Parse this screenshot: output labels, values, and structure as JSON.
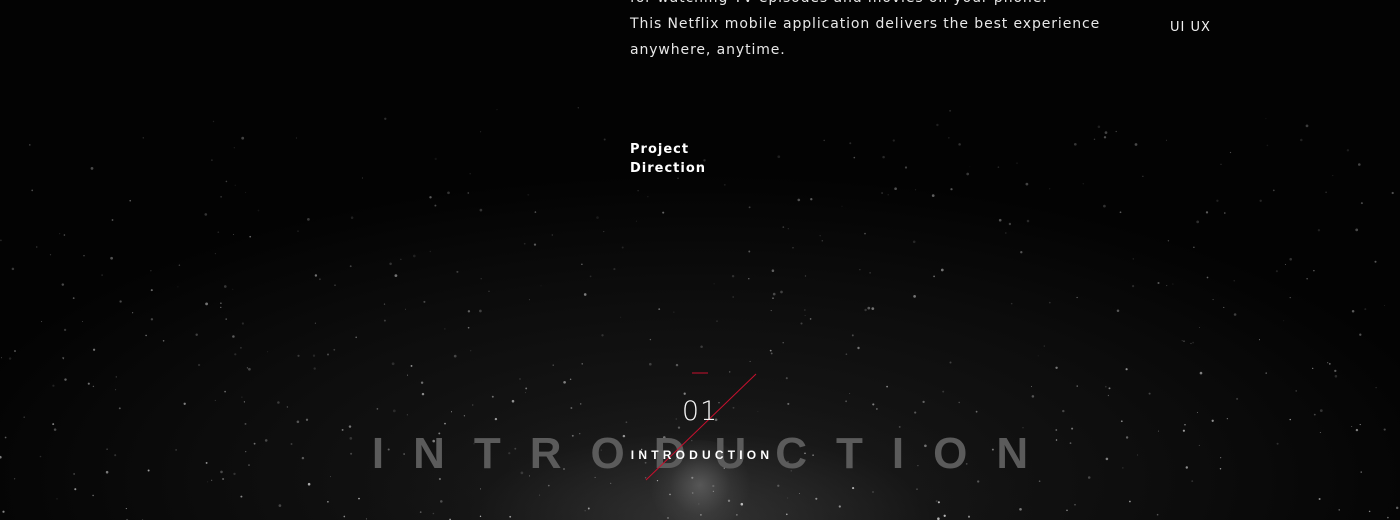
{
  "description": {
    "lines": [
      "for watching TV episodes and movies on your phone.",
      "This Netflix mobile application delivers the best experience",
      "anywhere, anytime."
    ]
  },
  "tags": "UI UX",
  "project": {
    "line1": "Project",
    "line2": "Direction"
  },
  "section": {
    "number": "01",
    "title_background": "INTRODUCTION",
    "title_foreground": "INTRODUCTION"
  },
  "colors": {
    "background": "#000000",
    "accent": "#c8102e",
    "faded_title": "#5b5b5b"
  }
}
